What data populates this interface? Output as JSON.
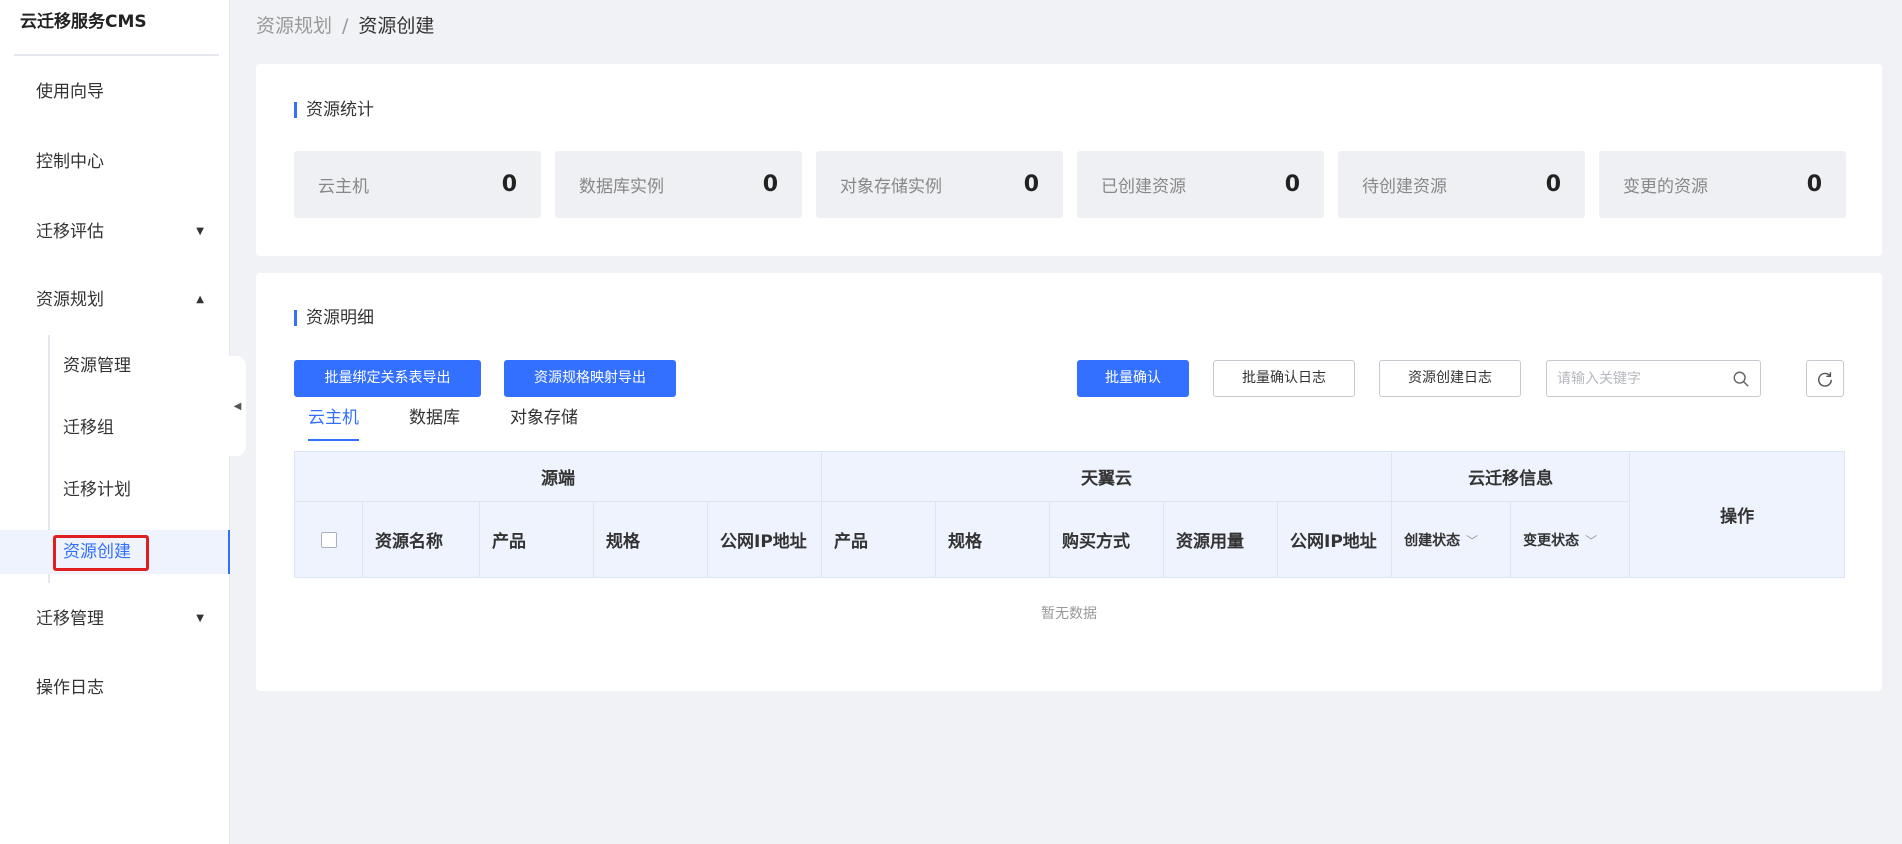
{
  "sidebar": {
    "logo": "云迁移服务CMS",
    "items": [
      {
        "label": "使用向导"
      },
      {
        "label": "控制中心"
      },
      {
        "label": "迁移评估"
      },
      {
        "label": "资源规划"
      },
      {
        "label": "迁移管理"
      },
      {
        "label": "操作日志"
      }
    ],
    "sub_items": [
      {
        "label": "资源管理"
      },
      {
        "label": "迁移组"
      },
      {
        "label": "迁移计划"
      },
      {
        "label": "资源创建"
      }
    ]
  },
  "breadcrumb": {
    "parent": "资源规划",
    "separator": "/",
    "current": "资源创建"
  },
  "stats": {
    "title": "资源统计",
    "items": [
      {
        "label": "云主机",
        "value": "0"
      },
      {
        "label": "数据库实例",
        "value": "0"
      },
      {
        "label": "对象存储实例",
        "value": "0"
      },
      {
        "label": "已创建资源",
        "value": "0"
      },
      {
        "label": "待创建资源",
        "value": "0"
      },
      {
        "label": "变更的资源",
        "value": "0"
      }
    ]
  },
  "detail": {
    "title": "资源明细",
    "buttons": {
      "export_binding": "批量绑定关系表导出",
      "export_mapping": "资源规格映射导出",
      "batch_confirm": "批量确认",
      "batch_confirm_log": "批量确认日志",
      "creation_log": "资源创建日志"
    },
    "search_placeholder": "请输入关键字",
    "tabs": [
      {
        "label": "云主机"
      },
      {
        "label": "数据库"
      },
      {
        "label": "对象存储"
      }
    ],
    "table": {
      "groups": {
        "source": "源端",
        "tianyi": "天翼云",
        "migration_info": "云迁移信息",
        "actions": "操作"
      },
      "source_cols": [
        "资源名称",
        "产品",
        "规格",
        "公网IP地址"
      ],
      "tianyi_cols": [
        "产品",
        "规格",
        "购买方式",
        "资源用量",
        "公网IP地址"
      ],
      "info_cols": [
        "创建状态",
        "变更状态"
      ]
    },
    "empty_text": "暂无数据"
  },
  "colors": {
    "accent": "#3370ff",
    "highlight_box": "#e02020"
  }
}
